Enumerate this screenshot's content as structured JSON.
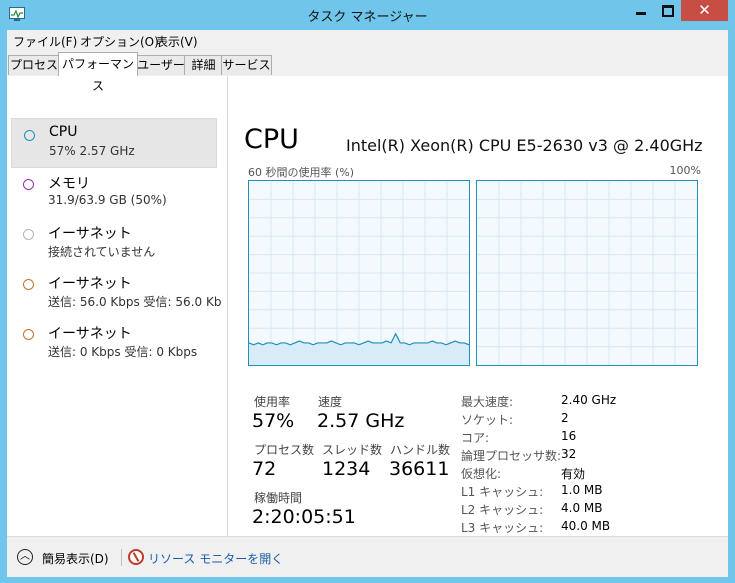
{
  "window": {
    "title": "タスク マネージャー"
  },
  "menu": [
    "ファイル(F)",
    "オプション(O)",
    "表示(V)"
  ],
  "tabs": [
    "プロセス",
    "パフォーマンス",
    "ユーザー",
    "詳細",
    "サービス"
  ],
  "active_tab": "パフォーマンス",
  "sidebar": {
    "items": [
      {
        "title": "CPU",
        "sub": "57% 2.57 GHz",
        "color": "#1e8fbf"
      },
      {
        "title": "メモリ",
        "sub": "31.9/63.9 GB (50%)",
        "color": "#9a30a8"
      },
      {
        "title": "イーサネット",
        "sub": "接続されていません",
        "color": "#b5b5b5"
      },
      {
        "title": "イーサネット",
        "sub": "送信: 56.0 Kbps 受信: 56.0 Kb",
        "color": "#c2742a"
      },
      {
        "title": "イーサネット",
        "sub": "送信: 0 Kbps 受信: 0 Kbps",
        "color": "#c2742a"
      }
    ]
  },
  "main": {
    "heading": "CPU",
    "model": "Intel(R) Xeon(R) CPU E5-2630 v3 @ 2.40GHz",
    "graph_label": "60 秒間の使用率 (%)",
    "graph_max": "100%",
    "stats": {
      "utilization_label": "使用率",
      "utilization": "57%",
      "speed_label": "速度",
      "speed": "2.57 GHz",
      "processes_label": "プロセス数",
      "processes": "72",
      "threads_label": "スレッド数",
      "threads": "1234",
      "handles_label": "ハンドル数",
      "handles": "36611",
      "uptime_label": "稼働時間",
      "uptime": "2:20:05:51"
    },
    "specs": [
      {
        "label": "最大速度:",
        "value": "2.40 GHz"
      },
      {
        "label": "ソケット:",
        "value": "2"
      },
      {
        "label": "コア:",
        "value": "16"
      },
      {
        "label": "論理プロセッサ数:",
        "value": "32"
      },
      {
        "label": "仮想化:",
        "value": "有効"
      },
      {
        "label": "L1 キャッシュ:",
        "value": "1.0 MB"
      },
      {
        "label": "L2 キャッシュ:",
        "value": "4.0 MB"
      },
      {
        "label": "L3 キャッシュ:",
        "value": "40.0 MB"
      }
    ],
    "graph_series_pct": [
      12,
      11,
      12,
      11,
      12,
      12,
      11,
      12,
      12,
      11,
      12,
      13,
      12,
      12,
      11,
      12,
      12,
      12,
      13,
      12,
      11,
      12,
      12,
      12,
      11,
      12,
      13,
      12,
      12,
      12,
      13,
      12,
      17,
      12,
      12,
      11,
      12,
      12,
      12,
      12,
      13,
      12,
      12,
      11,
      12,
      13,
      12,
      12,
      11
    ]
  },
  "footer": {
    "fewer_details": "簡易表示(D)",
    "resource_monitor": "リソース モニターを開く"
  },
  "colors": {
    "accent": "#1e8fbf",
    "titlebar": "#6fc6ea",
    "close": "#c74e44"
  }
}
